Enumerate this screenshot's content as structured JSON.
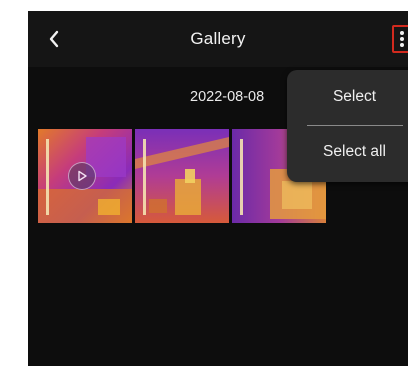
{
  "header": {
    "title": "Gallery",
    "back_icon": "chevron-left-icon",
    "more_icon": "more-vertical-icon",
    "highlight_color": "#d22a1e"
  },
  "gallery": {
    "date_group": "2022-08-08",
    "items": [
      {
        "type": "video",
        "icon": "play-icon"
      },
      {
        "type": "photo"
      },
      {
        "type": "photo"
      }
    ]
  },
  "menu": {
    "items": [
      {
        "label": "Select"
      },
      {
        "label": "Select all"
      }
    ]
  },
  "colors": {
    "background": "#0d0d0d",
    "menu_background": "#2c2c2c",
    "text": "#f2f2f2"
  }
}
